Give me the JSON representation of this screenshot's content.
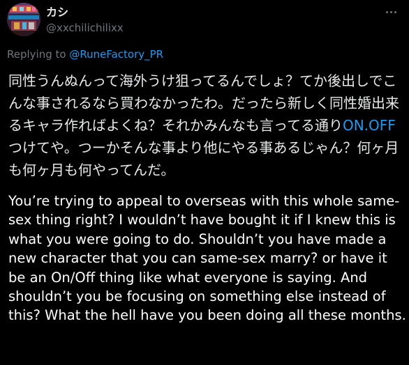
{
  "tweet": {
    "author": {
      "display_name": "カシ",
      "handle": "@xxchilichilixx",
      "avatar_icon": "profile-avatar"
    },
    "more_icon": "more-horizontal-icon",
    "reply_prefix": "Replying to ",
    "reply_to": "@RuneFactory_PR",
    "text_jp_before": "同性うんぬんって海外うけ狙ってるんでしょ？てか後出しでこんな事されるなら買わなかったわ。だったら新しく同性婚出来るキャラ作ればよくね？それかみんなも言ってる通り",
    "text_jp_link": "ON.OFF",
    "text_jp_after": "つけてや。つーかそんな事より他にやる事あるじゃん？何ヶ月も何ヶ月も何やってんだ。",
    "translation": "You’re trying to appeal to overseas with this whole same-sex thing right? I wouldn’t have bought it if I knew this is what you were going to do. Shouldn’t you have made a new character that you can same-sex marry? or have it be an On/Off thing like what everyone is saying. And shouldn’t you be focusing on something else instead of this? What the hell have you been doing all these months."
  },
  "colors": {
    "background": "#000000",
    "text": "#e7e9ea",
    "muted": "#71767b",
    "link": "#1d9bf0"
  }
}
